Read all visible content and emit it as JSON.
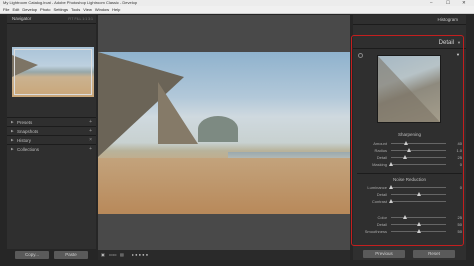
{
  "window": {
    "title": "My Lightroom Catalog.lrcat - Adobe Photoshop Lightroom Classic - Develop",
    "controls": [
      "–",
      "☐",
      "✕"
    ]
  },
  "menu": [
    "File",
    "Edit",
    "Develop",
    "Photo",
    "Settings",
    "Tools",
    "View",
    "Window",
    "Help"
  ],
  "left_panel": {
    "navigator": {
      "label": "Navigator",
      "zooms": "FIT   FILL   1:1   3:1"
    },
    "sections": [
      {
        "label": "Presets"
      },
      {
        "label": "Snapshots"
      },
      {
        "label": "History"
      },
      {
        "label": "Collections"
      }
    ],
    "copy_label": "Copy...",
    "paste_label": "Paste"
  },
  "right_panel": {
    "histogram_label": "Histogram",
    "detail_label": "Detail",
    "sharpening": {
      "title": "Sharpening",
      "sliders": [
        {
          "label": "Amount",
          "value": "40",
          "level": 0.27
        },
        {
          "label": "Radius",
          "value": "1.0",
          "level": 0.33
        },
        {
          "label": "Detail",
          "value": "25",
          "level": 0.25
        },
        {
          "label": "Masking",
          "value": "0",
          "level": 0.0
        }
      ]
    },
    "noise_reduction": {
      "title": "Noise Reduction",
      "sliders": [
        {
          "label": "Luminance",
          "value": "0",
          "level": 0.0
        },
        {
          "label": "Detail",
          "value": "",
          "level": 0.5
        },
        {
          "label": "Contrast",
          "value": "",
          "level": 0.0
        },
        {
          "label": "Color",
          "value": "25",
          "level": 0.25
        },
        {
          "label": "Detail",
          "value": "50",
          "level": 0.5
        },
        {
          "label": "Smoothness",
          "value": "50",
          "level": 0.5
        }
      ]
    },
    "previous_label": "Previous",
    "reset_label": "Reset"
  },
  "highlight_color": "#c41f1f"
}
